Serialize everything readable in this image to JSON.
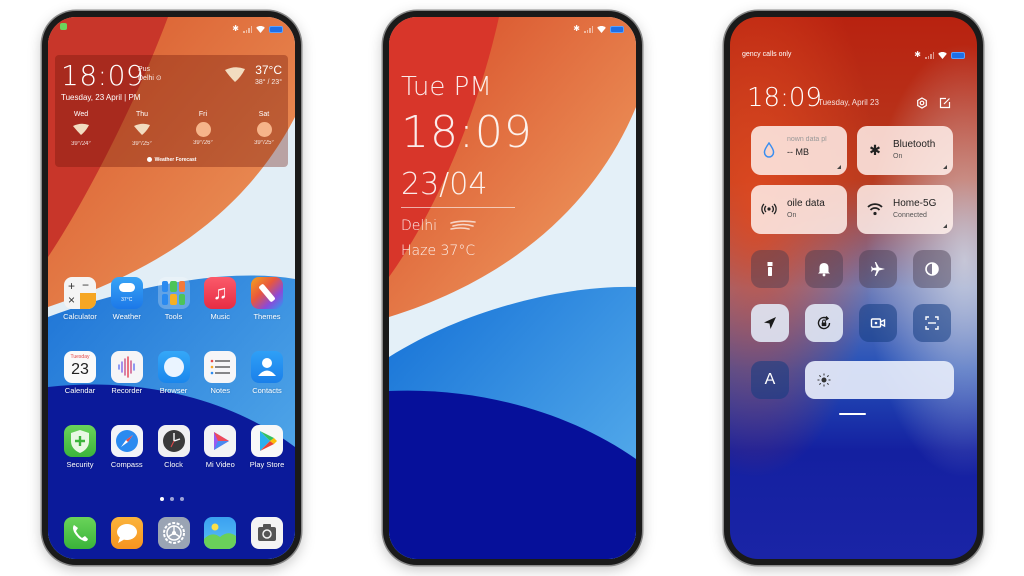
{
  "phones": {
    "home": {
      "status": {
        "bluetooth": "bluetooth-icon",
        "battery": "battery-icon"
      },
      "widget": {
        "time": "18:09",
        "aqi_label": "Pus",
        "city": "Delhi",
        "date": "Tuesday, 23 April | PM",
        "temp": "37°C",
        "range": "38° / 23°",
        "forecast": [
          {
            "day": "Wed",
            "range": "39°/24°",
            "icon": "haze-icon"
          },
          {
            "day": "Thu",
            "range": "39°/25°",
            "icon": "haze-icon"
          },
          {
            "day": "Fri",
            "range": "39°/26°",
            "icon": "sun-icon"
          },
          {
            "day": "Sat",
            "range": "39°/25°",
            "icon": "sun-icon"
          }
        ],
        "footer": "Weather Forecast"
      },
      "apps_row1": [
        {
          "label": "Calculator"
        },
        {
          "label": "Weather",
          "badge": "37°C"
        },
        {
          "label": "Tools"
        },
        {
          "label": "Music"
        },
        {
          "label": "Themes"
        }
      ],
      "apps_row2": [
        {
          "label": "Calendar",
          "day": "Tuesday",
          "date": "23"
        },
        {
          "label": "Recorder"
        },
        {
          "label": "Browser"
        },
        {
          "label": "Notes"
        },
        {
          "label": "Contacts"
        }
      ],
      "apps_row3": [
        {
          "label": "Security"
        },
        {
          "label": "Compass"
        },
        {
          "label": "Clock"
        },
        {
          "label": "Mi Video"
        },
        {
          "label": "Play Store"
        }
      ],
      "page_indicator": {
        "pages": 3,
        "active": 1
      },
      "dock": [
        "Phone",
        "Messages",
        "Settings",
        "Gallery",
        "Camera"
      ]
    },
    "lock": {
      "day": "Tue PM",
      "time": "18:09",
      "date": "23/04",
      "city": "Delhi",
      "condition": "Haze 37°C"
    },
    "control_center": {
      "carrier": "gency calls only",
      "time": "18:09",
      "date": "Tuesday, April 23",
      "tiles": [
        {
          "title": "nown data pl",
          "subtitle": "-- MB",
          "icon": "data-drop-icon"
        },
        {
          "title": "Bluetooth",
          "subtitle": "On",
          "icon": "bluetooth-icon"
        },
        {
          "title": "oile data",
          "subtitle": "On",
          "icon": "mobile-data-icon"
        },
        {
          "title": "Home-5G",
          "subtitle": "Connected",
          "icon": "wifi-icon"
        }
      ],
      "toggles": [
        "flashlight",
        "silent",
        "airplane-mode",
        "dark-mode",
        "location",
        "rotation-lock",
        "screen-recorder",
        "scanner"
      ],
      "auto_brightness_label": "A"
    }
  }
}
